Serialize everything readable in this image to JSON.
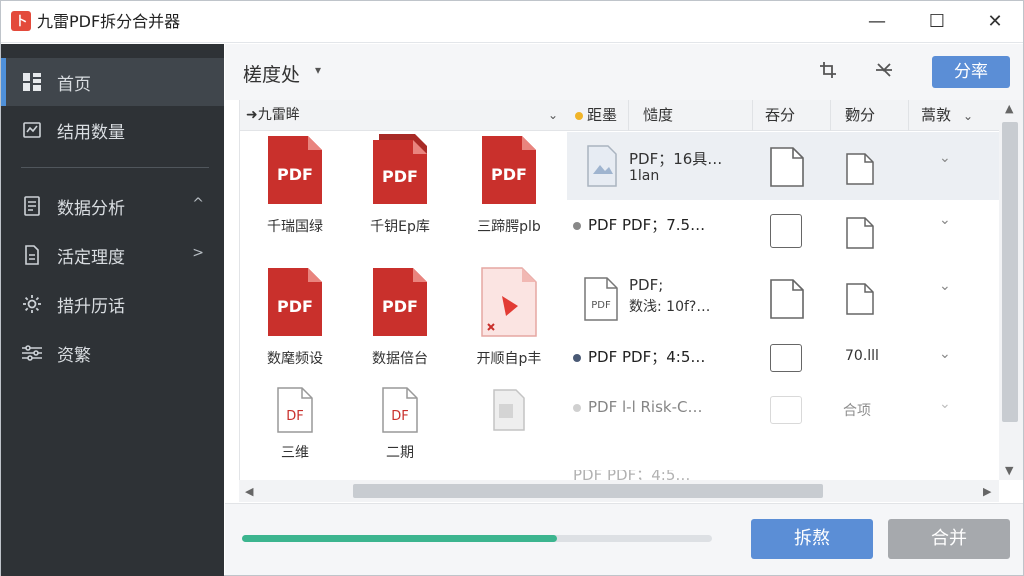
{
  "app": {
    "title": "九雷PDF拆分合并器",
    "logo_glyph": "卜"
  },
  "window_controls": {
    "minimize": "—",
    "maximize": "☐",
    "close": "✕"
  },
  "sidebar": {
    "items": [
      {
        "label": "首页",
        "icon": "grid-icon",
        "active": true
      },
      {
        "label": "结用数量",
        "icon": "chart-icon"
      },
      {
        "label": "数据分析",
        "icon": "document-icon",
        "arrow": "^"
      },
      {
        "label": "活定理度",
        "icon": "file-icon",
        "arrow": ">"
      },
      {
        "label": "措升历话",
        "icon": "gear-icon"
      },
      {
        "label": "资繁",
        "icon": "sliders-icon"
      }
    ]
  },
  "toolbar": {
    "sort_label": "槎度处",
    "sort_caret": "▾",
    "primary_label": "分率"
  },
  "files_pane": {
    "header": "➜九雷眸",
    "header_caret": "⌄",
    "files": [
      {
        "name": "千瑞国绿",
        "badge": "PDF"
      },
      {
        "name": "千钥Ep库",
        "badge": "PDF"
      },
      {
        "name": "三蹄腭plb",
        "badge": "PDF"
      },
      {
        "name": "数麾频设",
        "badge": "PDF"
      },
      {
        "name": "数据倍台",
        "badge": "PDF"
      },
      {
        "name": "开顺自p丰",
        "badge": ""
      },
      {
        "name": "三维",
        "badge": "DF"
      },
      {
        "name": "二期",
        "badge": "DF"
      },
      {
        "name": "",
        "badge": ""
      }
    ]
  },
  "list_pane": {
    "columns": [
      "距墨",
      "慥度",
      "吞分",
      "覅分",
      "蒿敦"
    ],
    "rows": [
      {
        "type_line1": "PDF；16具…",
        "type_line2": "1lan"
      },
      {
        "type_line1": "PDF  PDF；7.5…",
        "type_line2": ""
      },
      {
        "type_line1": "PDF;",
        "type_line2": "数浅: 10f?…"
      },
      {
        "type_line1": "PDF  PDF；4:5…",
        "type_line2": "",
        "col4": "70.lll"
      },
      {
        "type_line1": "PDF  l-l  Risk-C…",
        "type_line2": "",
        "col4": "合项"
      },
      {
        "type_line1": "PDF  PDF；4:5…",
        "type_line2": ""
      }
    ],
    "col_caret": "⌄"
  },
  "bottom": {
    "progress": 0.67,
    "split_label": "拆熬",
    "merge_label": "合并"
  },
  "colors": {
    "accent": "#5b8ed6",
    "sidebar": "#2e3236",
    "pdf_red": "#c9302c",
    "progress": "#3cb58f"
  }
}
